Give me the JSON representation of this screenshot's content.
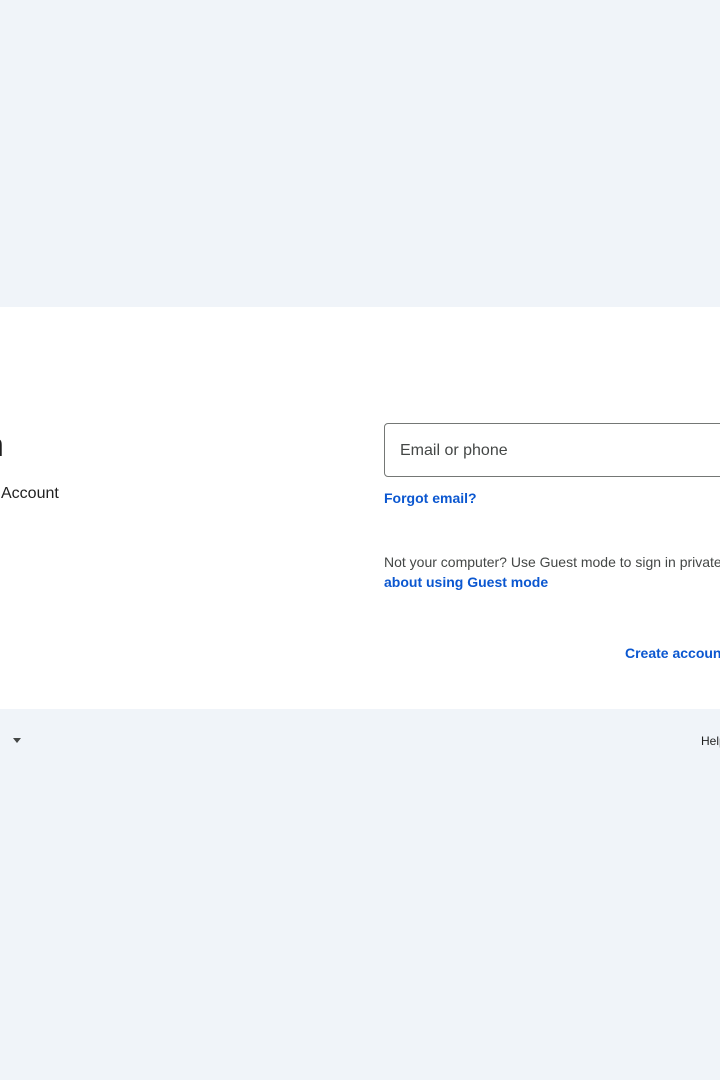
{
  "signin": {
    "heading_fragment": "n",
    "subtitle_fragment": "Account",
    "email_placeholder": "Email or phone",
    "forgot_email": "Forgot email?",
    "guest_text": "Not your computer? Use Guest mode to sign in privately.",
    "guest_link": "about using Guest mode",
    "create_account": "Create account"
  },
  "footer": {
    "language_icon": "chevron-down-icon",
    "help": "Help"
  },
  "colors": {
    "background": "#f0f4f9",
    "card": "#ffffff",
    "link": "#0b57d0"
  }
}
